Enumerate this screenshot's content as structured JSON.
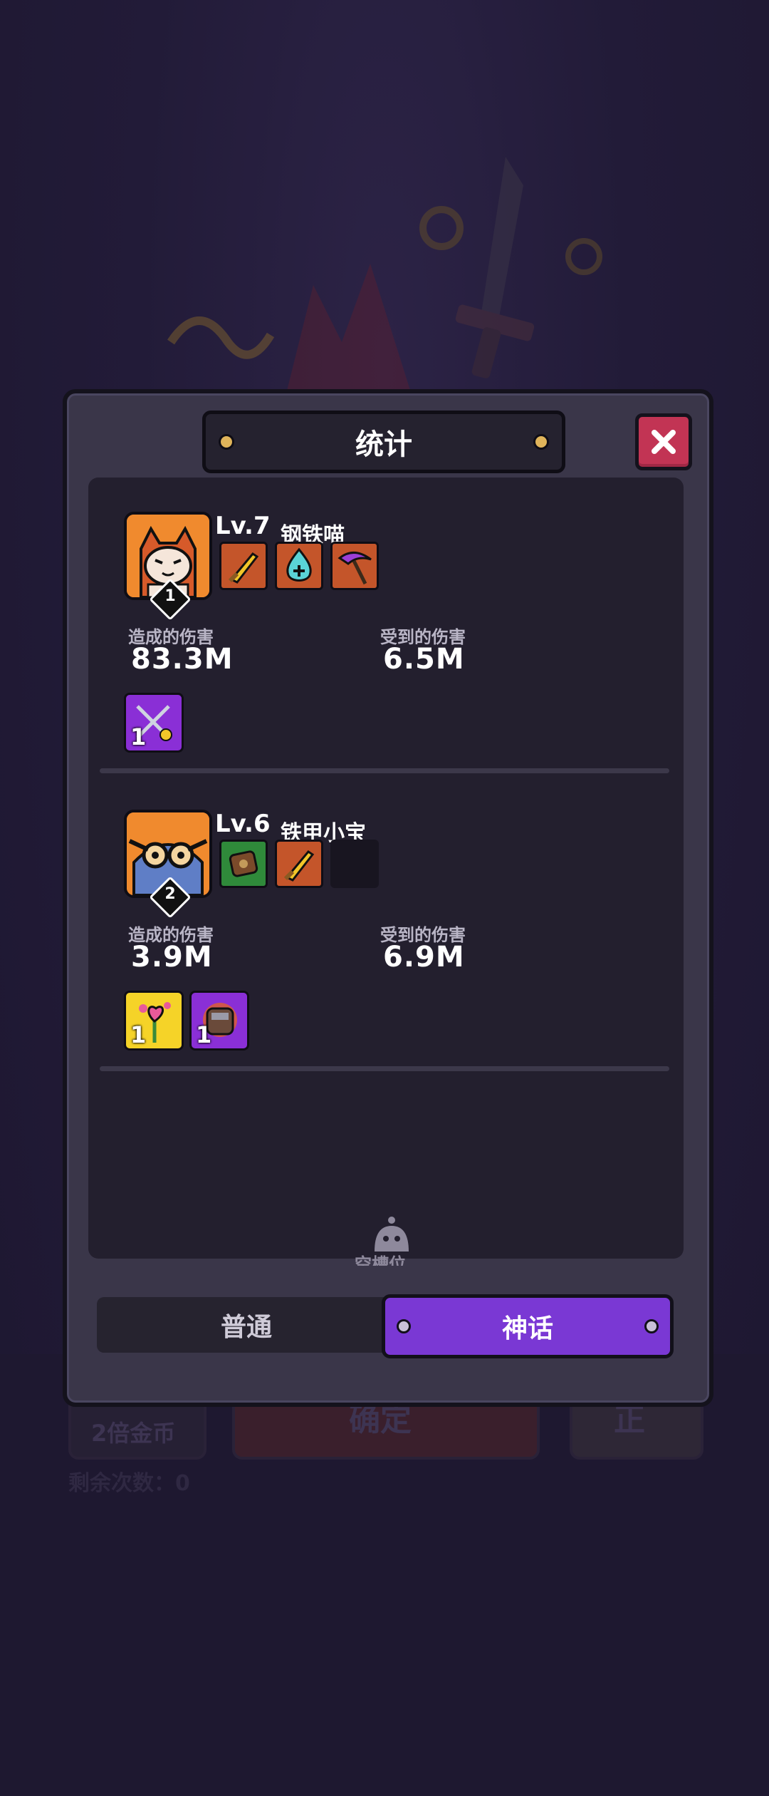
{
  "behind": {
    "left_button": "2倍金币",
    "center_button": "确定",
    "right_button": "正",
    "remaining": "剩余次数：0"
  },
  "modal": {
    "title": "统计",
    "close_icon": "close-x-icon"
  },
  "heroes": [
    {
      "rank": "1",
      "level": "Lv.7",
      "name": "钢铁喵",
      "equipment_icons": [
        "golden-sword-icon",
        "water-heal-icon",
        "purple-scythe-icon"
      ],
      "damage_dealt_label": "造成的伤害",
      "damage_dealt": "83.3M",
      "damage_taken_label": "受到的伤害",
      "damage_taken": "6.5M",
      "relics": [
        {
          "icon": "crossed-swords-icon",
          "count": "1",
          "color": "#8a2fd6"
        }
      ]
    },
    {
      "rank": "2",
      "level": "Lv.6",
      "name": "铁甲小宝",
      "equipment_icons": [
        "green-shield-icon",
        "golden-sword-icon",
        "empty-slot"
      ],
      "damage_dealt_label": "造成的伤害",
      "damage_dealt": "3.9M",
      "damage_taken_label": "受到的伤害",
      "damage_taken": "6.9M",
      "relics": [
        {
          "icon": "flower-heart-icon",
          "count": "1",
          "color": "#f5d328"
        },
        {
          "icon": "armor-glove-icon",
          "count": "1",
          "color": "#8a2fd6"
        }
      ]
    }
  ],
  "loading": {
    "icon": "robot-helmet-icon",
    "text": "空槽位"
  },
  "tabs": {
    "normal": "普通",
    "myth": "神话",
    "active": "神话"
  },
  "colors": {
    "background": "#201a33",
    "modal": "#3a3649",
    "close": "#c23454",
    "myth_tab": "#7a38d4",
    "avatar": "#f08a2e"
  }
}
